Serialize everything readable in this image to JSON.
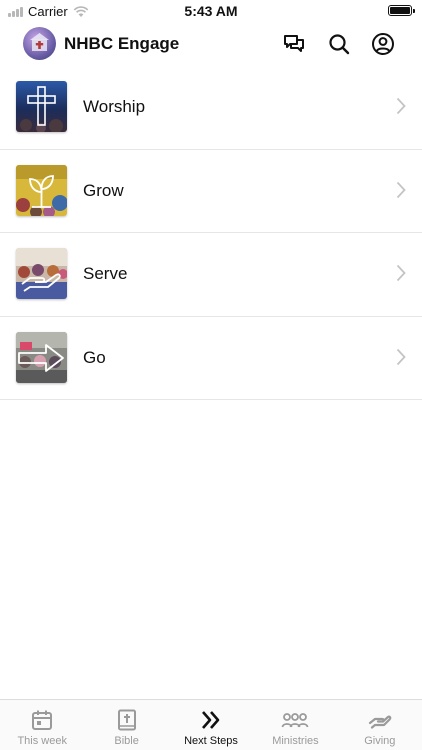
{
  "status_bar": {
    "carrier": "Carrier",
    "time": "5:43 AM"
  },
  "header": {
    "title": "NHBC Engage",
    "icons": [
      "chat-icon",
      "search-icon",
      "account-icon"
    ]
  },
  "menu_items": [
    {
      "label": "Worship",
      "icon": "cross-icon"
    },
    {
      "label": "Grow",
      "icon": "sprout-icon"
    },
    {
      "label": "Serve",
      "icon": "helping-hand-icon"
    },
    {
      "label": "Go",
      "icon": "arrow-right-icon"
    }
  ],
  "tab_bar": {
    "tabs": [
      {
        "label": "This week",
        "icon": "calendar-icon",
        "active": false
      },
      {
        "label": "Bible",
        "icon": "bible-icon",
        "active": false
      },
      {
        "label": "Next Steps",
        "icon": "double-chevron-icon",
        "active": true
      },
      {
        "label": "Ministries",
        "icon": "people-icon",
        "active": false
      },
      {
        "label": "Giving",
        "icon": "giving-hand-icon",
        "active": false
      }
    ]
  },
  "colors": {
    "active_tab": "#111111",
    "inactive_tab": "#9a9a9a",
    "divider": "#e6e6e6",
    "chevron": "#c4c4c4"
  }
}
